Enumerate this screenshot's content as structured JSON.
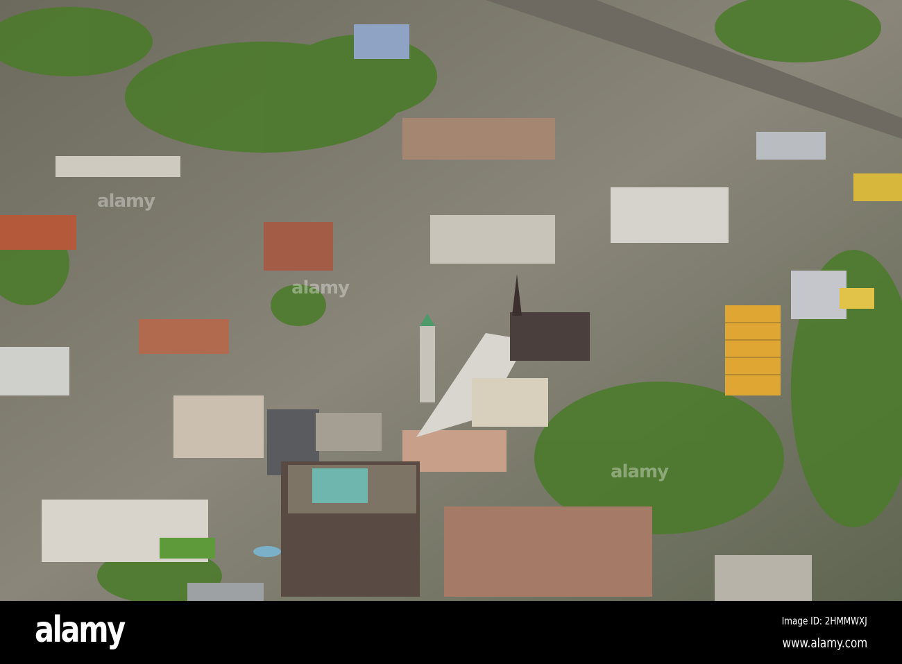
{
  "watermark": {
    "logo": "alamy",
    "image_id": "Image ID: 2HMMWXJ",
    "url": "www.alamy.com"
  },
  "colors": {
    "vegetation": "#4f7a2e",
    "roofs": "#9a9488",
    "tower": "#e0a634",
    "bar": "#000000"
  }
}
